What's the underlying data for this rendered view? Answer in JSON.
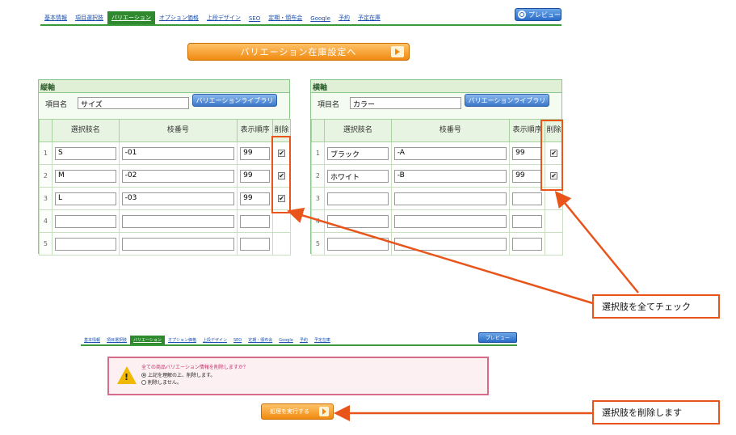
{
  "tabs": [
    "基本情報",
    "項目選択肢",
    "バリエーション",
    "オプション価格",
    "上段デザイン",
    "SEO",
    "定期・頒布会",
    "Google",
    "予約",
    "予定在庫"
  ],
  "active_tab": "バリエーション",
  "preview_label": "プレビュー",
  "variation_stock_button": "バリエーション在庫設定へ",
  "columns": {
    "choice_name": "選択肢名",
    "branch_no": "枝番号",
    "display_order": "表示順序",
    "delete": "削除"
  },
  "vertical": {
    "title": "縦軸",
    "item_name_label": "項目名",
    "item_name_value": "サイズ",
    "library_button": "バリエーションライブラリ",
    "rows": [
      {
        "idx": "1",
        "name": "S",
        "branch": "-01",
        "order": "99",
        "checked": true
      },
      {
        "idx": "2",
        "name": "M",
        "branch": "-02",
        "order": "99",
        "checked": true
      },
      {
        "idx": "3",
        "name": "L",
        "branch": "-03",
        "order": "99",
        "checked": true
      },
      {
        "idx": "4",
        "name": "",
        "branch": "",
        "order": "",
        "checked": false
      },
      {
        "idx": "5",
        "name": "",
        "branch": "",
        "order": "",
        "checked": false
      }
    ]
  },
  "horizontal": {
    "title": "横軸",
    "item_name_label": "項目名",
    "item_name_value": "カラー",
    "library_button": "バリエーションライブラリ",
    "rows": [
      {
        "idx": "1",
        "name": "ブラック",
        "branch": "-A",
        "order": "99",
        "checked": true
      },
      {
        "idx": "2",
        "name": "ホワイト",
        "branch": "-B",
        "order": "99",
        "checked": true
      },
      {
        "idx": "3",
        "name": "",
        "branch": "",
        "order": "",
        "checked": false
      },
      {
        "idx": "4",
        "name": "",
        "branch": "",
        "order": "",
        "checked": false
      },
      {
        "idx": "5",
        "name": "",
        "branch": "",
        "order": "",
        "checked": false
      }
    ]
  },
  "callout_check_all": "選択肢を全てチェック",
  "callout_delete": "選択肢を削除します",
  "confirm": {
    "question": "全ての商品バリエーション情報を削除しますか？",
    "option_yes": "上記を理解の上、削除します。",
    "option_no": "削除しません。"
  },
  "execute_button": "処理を実行する",
  "colors": {
    "accent_green": "#3a9a3a",
    "highlight_orange": "#e8541a",
    "button_orange": "#f08a10"
  }
}
